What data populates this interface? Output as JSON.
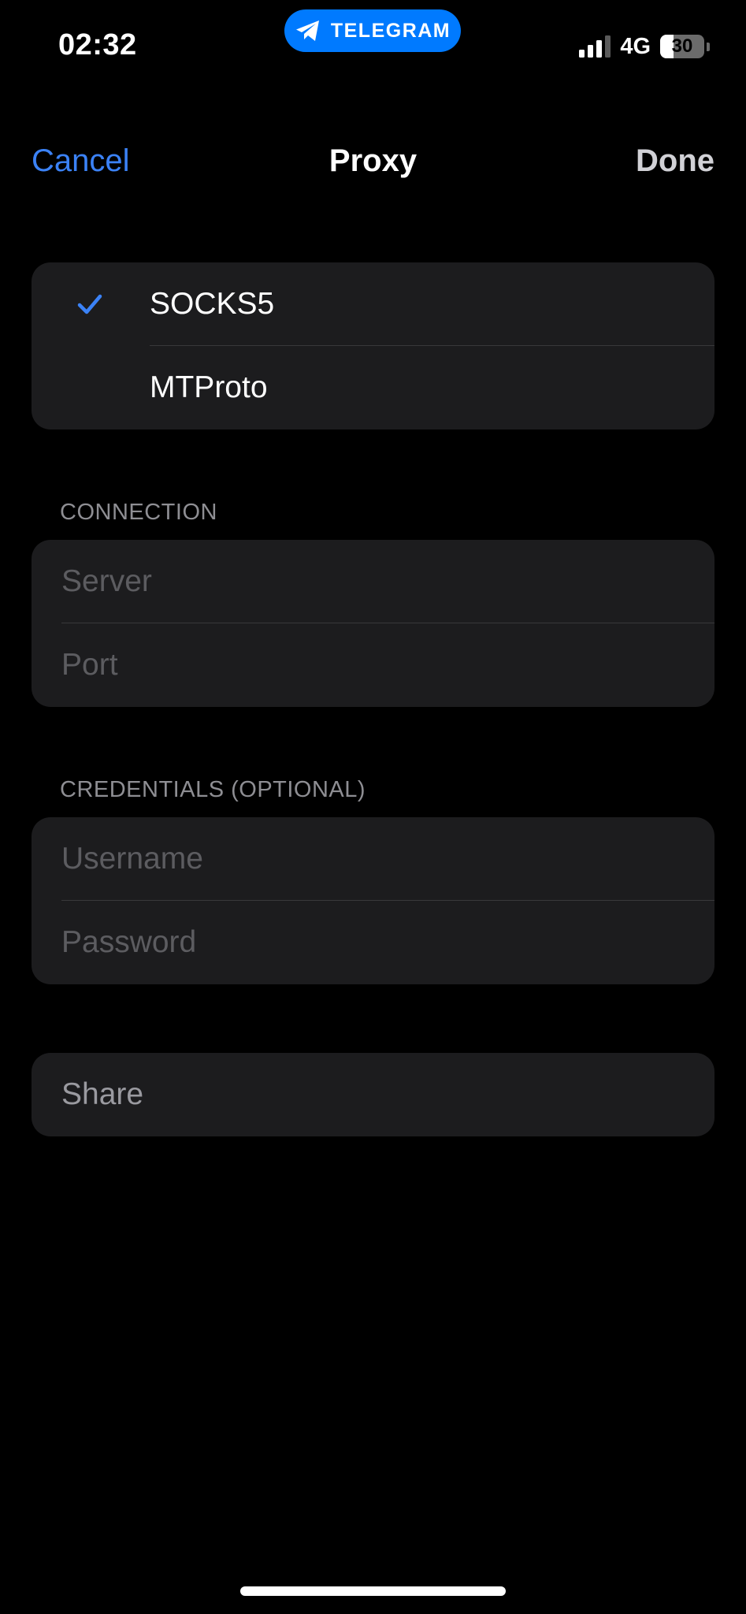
{
  "status_bar": {
    "time": "02:32",
    "pill_label": "TELEGRAM",
    "pill_icon": "telegram-plane-icon",
    "pill_color": "#007aff",
    "network": "4G",
    "battery_level": "30",
    "battery_fraction": 0.3,
    "signal_bars_active": 3,
    "signal_bars_total": 4
  },
  "nav": {
    "cancel_label": "Cancel",
    "title": "Proxy",
    "done_label": "Done",
    "accent_color": "#3b82f6"
  },
  "proxy_types": [
    {
      "label": "SOCKS5",
      "selected": true
    },
    {
      "label": "MTProto",
      "selected": false
    }
  ],
  "connection": {
    "header": "CONNECTION",
    "server_placeholder": "Server",
    "port_placeholder": "Port"
  },
  "credentials": {
    "header": "CREDENTIALS (OPTIONAL)",
    "username_placeholder": "Username",
    "password_placeholder": "Password"
  },
  "share": {
    "label": "Share"
  }
}
